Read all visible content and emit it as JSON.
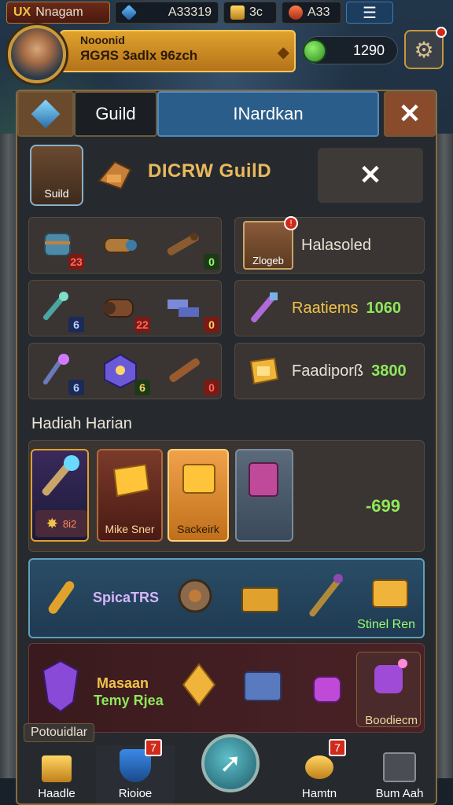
{
  "topbar": {
    "name": "Nnagam",
    "name_prefix": "UX",
    "gems": "A33319",
    "gold": "3c",
    "keys": "A33",
    "menu_icon": "menu-icon"
  },
  "profile": {
    "name": "Nooonid",
    "subtitle": "ЯGЯS 3adlx 96zch",
    "gem_count": "1290"
  },
  "tabs": {
    "guild": "Guild",
    "market": "INardkan"
  },
  "guild": {
    "emblem_label": "Suild",
    "title": "DICRW GuilD"
  },
  "grid_badges": {
    "r1": [
      "23",
      "",
      "0"
    ],
    "r2": [
      "6",
      "22",
      "0"
    ],
    "r3": [
      "6",
      "6",
      "0"
    ]
  },
  "side_cards": [
    {
      "label": "Halasoled",
      "value": "",
      "icon_label": "Zlogeb"
    },
    {
      "label": "Raatiems",
      "value": "1060"
    },
    {
      "label": "Faadiporß",
      "value": "3800"
    }
  ],
  "daily": {
    "title": "Hadiah Harian",
    "badge": "8i2",
    "card1": "Mike Sner",
    "card2": "Sackeirk",
    "total": "-699"
  },
  "strip": {
    "label": "SpicaTRS",
    "right": "Stinel Ren"
  },
  "bottom_panel": {
    "line1": "Masaan",
    "line2": "Temy Rjea",
    "right": "Boodiecm"
  },
  "nav": {
    "section": "Potouidlar",
    "items": [
      "Haadle",
      "Rioioe",
      "Hamtn",
      "Bum Aah"
    ],
    "badges": [
      "7",
      "7"
    ]
  },
  "colors": {
    "gold": "#f0c34a",
    "green": "#8ee85a",
    "blue_tab": "#2b5d8a",
    "panel": "#262a2e"
  }
}
